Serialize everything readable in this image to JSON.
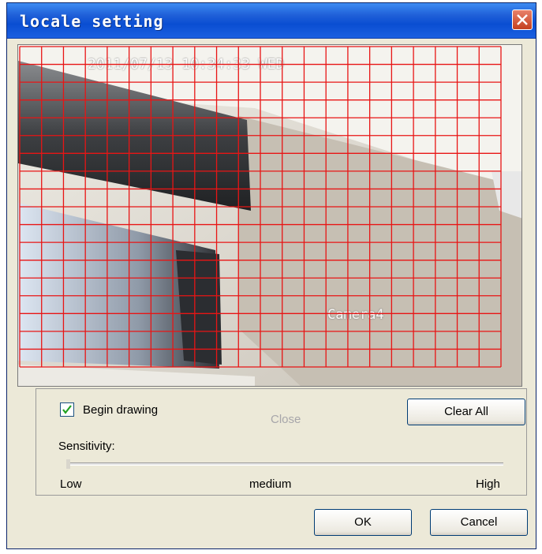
{
  "window": {
    "title": "locale setting"
  },
  "video": {
    "timestamp": "2011/07/13 10:34:33 WED",
    "camera_label": "Camera4",
    "grid_color": "#e81515"
  },
  "controls": {
    "begin_drawing_label": "Begin drawing",
    "begin_drawing_checked": true,
    "close_label": "Close",
    "clear_all_label": "Clear All",
    "sensitivity_label": "Sensitivity:",
    "sensitivity_levels": {
      "low": "Low",
      "medium": "medium",
      "high": "High"
    },
    "sensitivity_value": 0
  },
  "footer": {
    "ok_label": "OK",
    "cancel_label": "Cancel"
  },
  "colors": {
    "title_bar": "#0a4ed2",
    "dialog_bg": "#ece9d8",
    "close_button": "#c4401f"
  }
}
